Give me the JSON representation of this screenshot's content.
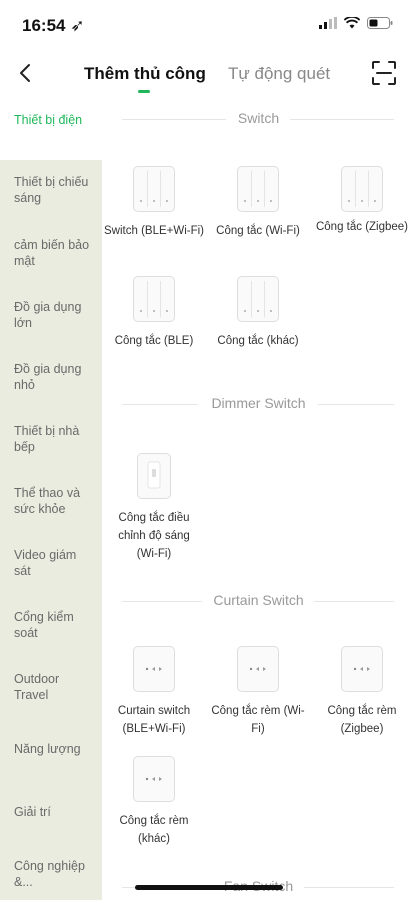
{
  "status_bar": {
    "time": "16:54 ➶"
  },
  "header": {
    "tab_manual": "Thêm thủ công",
    "tab_auto": "Tự động quét"
  },
  "sidebar": {
    "items": [
      "Thiết bị điện",
      "Thiết bị chiếu sáng",
      "cảm biến bảo mật",
      "Đồ gia dụng lớn",
      "Đồ gia dụng nhỏ",
      "Thiết bị nhà bếp",
      "Thể thao và sức khỏe",
      "Video giám sát",
      "Cổng kiểm soát",
      "Outdoor Travel",
      "Năng lượng",
      "Giải trí",
      "Công nghiệp &..."
    ]
  },
  "sections": [
    {
      "title": "Switch",
      "devices": [
        {
          "name": "Switch (BLE+Wi-Fi)",
          "icon": "three-gang-switch-icon"
        },
        {
          "name": "Công tắc (Wi-Fi)",
          "icon": "three-gang-switch-icon"
        },
        {
          "name": "Công tắc (Zigbee)",
          "icon": "three-gang-switch-icon"
        },
        {
          "name": "Công tắc (BLE)",
          "icon": "three-gang-switch-icon"
        },
        {
          "name": "Công tắc (khác)",
          "icon": "three-gang-switch-icon"
        }
      ]
    },
    {
      "title": "Dimmer Switch",
      "devices": [
        {
          "name": "Công tắc điều chỉnh độ sáng (Wi-Fi)",
          "icon": "dimmer-switch-icon"
        }
      ]
    },
    {
      "title": "Curtain Switch",
      "devices": [
        {
          "name": "Curtain switch (BLE+Wi-Fi)",
          "icon": "curtain-switch-icon"
        },
        {
          "name": "Công tắc rèm (Wi-Fi)",
          "icon": "curtain-switch-icon"
        },
        {
          "name": "Công tắc rèm (Zigbee)",
          "icon": "curtain-switch-icon"
        },
        {
          "name": "Công tắc rèm (khác)",
          "icon": "curtain-switch-icon"
        }
      ]
    },
    {
      "title": "Fan Switch",
      "devices": []
    }
  ],
  "colors": {
    "accent": "#1fb85a",
    "sidebar_bg": "#e9ecdf"
  }
}
